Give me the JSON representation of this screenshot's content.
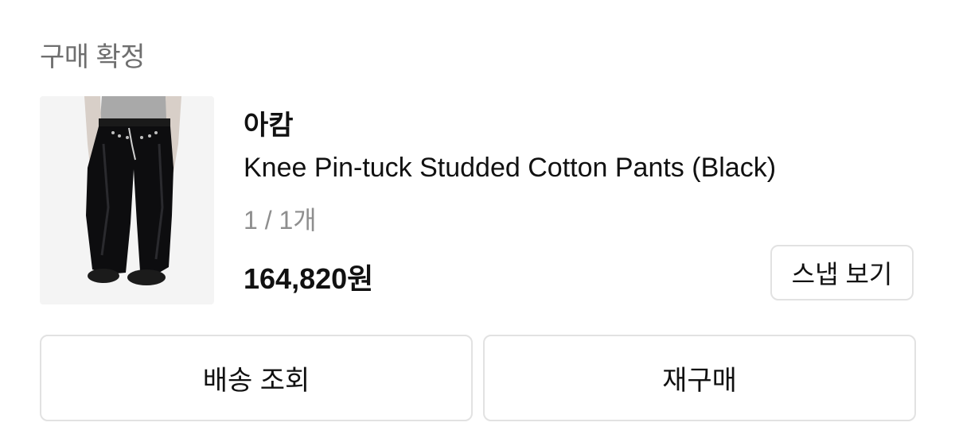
{
  "order": {
    "status": "구매 확정",
    "brand": "아캄",
    "product_name": "Knee Pin-tuck Studded Cotton Pants (Black)",
    "quantity": "1 / 1개",
    "price": "164,820원",
    "snap_button": "스냅 보기"
  },
  "actions": {
    "track_delivery": "배송 조회",
    "reorder": "재구매"
  },
  "product_image": {
    "icon": "pants-product-photo"
  }
}
